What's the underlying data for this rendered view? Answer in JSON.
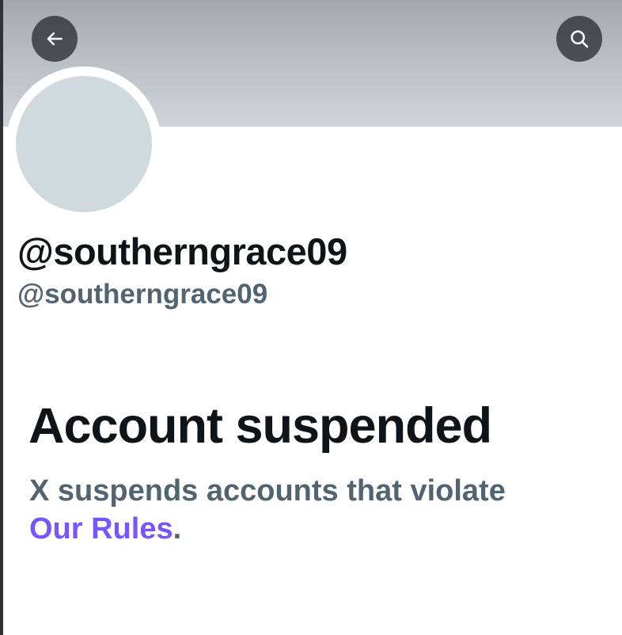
{
  "header": {
    "back_icon": "arrow-left-icon",
    "search_icon": "search-icon"
  },
  "profile": {
    "display_name": "@southerngrace09",
    "handle": "@southerngrace09"
  },
  "suspension": {
    "title": "Account suspended",
    "message": "X suspends accounts that violate",
    "link_text": "Our Rules",
    "trailing": "."
  },
  "colors": {
    "link": "#7856ff",
    "secondary_text": "#536471",
    "primary_text": "#0f1419",
    "avatar_placeholder": "#cfd9de"
  }
}
